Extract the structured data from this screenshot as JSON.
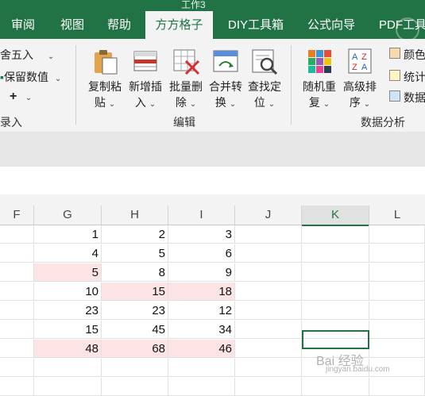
{
  "title_fragment": "工作3",
  "tabs": [
    {
      "label": "审阅"
    },
    {
      "label": "视图"
    },
    {
      "label": "帮助"
    },
    {
      "label": "方方格子"
    },
    {
      "label": "DIY工具箱"
    },
    {
      "label": "公式向导"
    },
    {
      "label": "PDF工具"
    }
  ],
  "ribbon": {
    "left_group": {
      "round_label": "舍五入",
      "keep_label": "保留数值",
      "plus_label": "+",
      "group_fragment": "录入"
    },
    "edit_group": {
      "label": "编辑",
      "buttons": [
        {
          "l1": "复制粘",
          "l2": "贴"
        },
        {
          "l1": "新增插",
          "l2": "入"
        },
        {
          "l1": "批量删",
          "l2": "除"
        },
        {
          "l1": "合并转",
          "l2": "换"
        },
        {
          "l1": "查找定",
          "l2": "位"
        }
      ]
    },
    "data_group": {
      "label": "数据分析",
      "buttons": [
        {
          "l1": "随机重",
          "l2": "复"
        },
        {
          "l1": "高级排",
          "l2": "序"
        }
      ],
      "small": [
        "颜色",
        "统计",
        "数据"
      ]
    }
  },
  "columns": [
    "F",
    "G",
    "H",
    "I",
    "J",
    "K",
    "L"
  ],
  "rows": [
    [
      "1",
      "2",
      "3"
    ],
    [
      "4",
      "5",
      "6"
    ],
    [
      "5",
      "8",
      "9"
    ],
    [
      "10",
      "15",
      "18"
    ],
    [
      "23",
      "23",
      "12"
    ],
    [
      "15",
      "45",
      "34"
    ],
    [
      "48",
      "68",
      "46"
    ]
  ],
  "highlight_color": "#fde4e4",
  "accent_color": "#217346",
  "watermark": {
    "main": "Bai 经验",
    "sub": "jingyan.baidu.com"
  }
}
